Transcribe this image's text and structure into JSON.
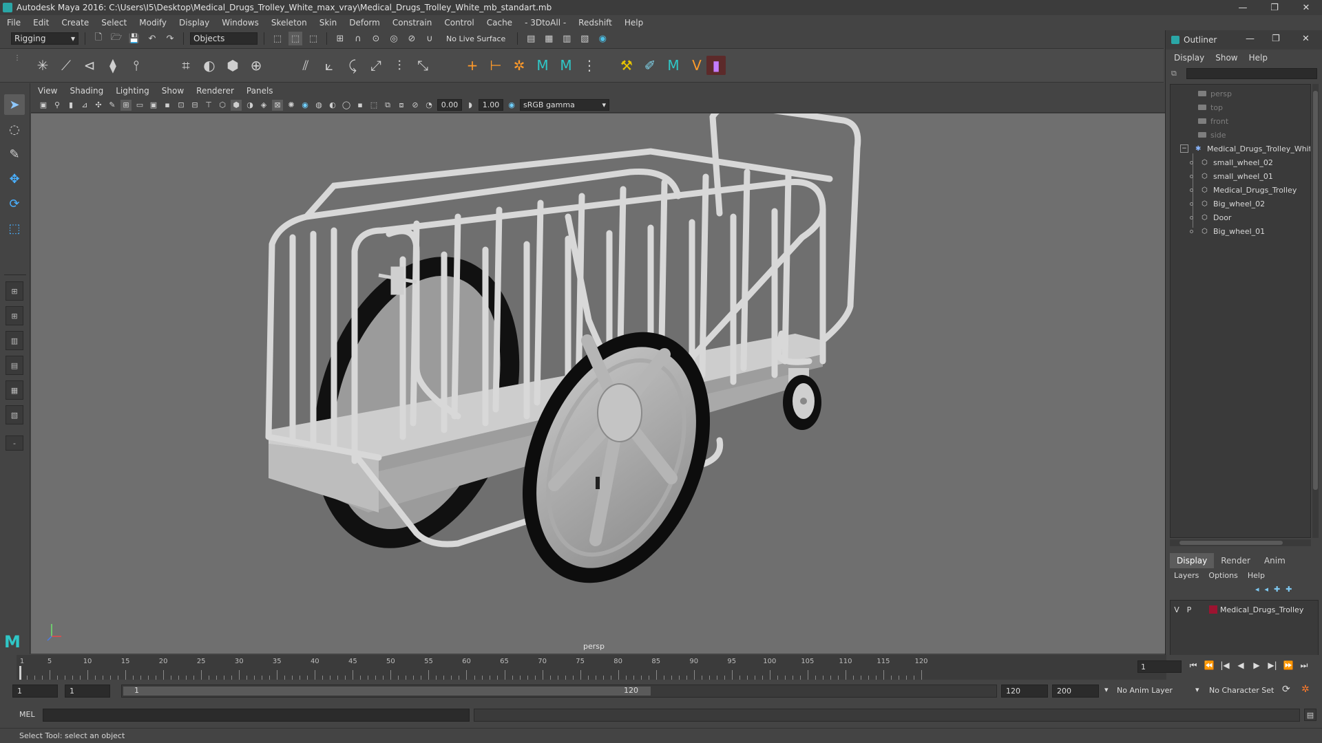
{
  "window": {
    "title": "Autodesk Maya 2016: C:\\Users\\I5\\Desktop\\Medical_Drugs_Trolley_White_max_vray\\Medical_Drugs_Trolley_White_mb_standart.mb",
    "controls": [
      "—",
      "❐",
      "✕"
    ]
  },
  "menubar": [
    "File",
    "Edit",
    "Create",
    "Select",
    "Modify",
    "Display",
    "Windows",
    "Skeleton",
    "Skin",
    "Deform",
    "Constrain",
    "Control",
    "Cache",
    "- 3DtoAll -",
    "Redshift",
    "Help"
  ],
  "statusline": {
    "menuset": "Rigging",
    "selection_mode": "Objects",
    "live_surface": "No Live Surface"
  },
  "panel": {
    "menu": [
      "View",
      "Shading",
      "Lighting",
      "Show",
      "Renderer",
      "Panels"
    ],
    "exposure": "0.00",
    "gamma": "1.00",
    "color_space": "sRGB gamma",
    "camera_label": "persp"
  },
  "outliner": {
    "title": "Outliner",
    "menu": [
      "Display",
      "Show",
      "Help"
    ],
    "cameras": [
      "persp",
      "top",
      "front",
      "side"
    ],
    "group": "Medical_Drugs_Trolley_White",
    "children": [
      "small_wheel_02",
      "small_wheel_01",
      "Medical_Drugs_Trolley",
      "Big_wheel_02",
      "Door",
      "Big_wheel_01"
    ]
  },
  "layer_editor": {
    "tabs": [
      "Display",
      "Render",
      "Anim"
    ],
    "active_tab": "Display",
    "menu": [
      "Layers",
      "Options",
      "Help"
    ],
    "layer": {
      "v": "V",
      "p": "P",
      "name": "Medical_Drugs_Trolley",
      "color": "#9c1430"
    }
  },
  "timeline": {
    "ticks": [
      1,
      5,
      10,
      15,
      20,
      25,
      30,
      35,
      40,
      45,
      50,
      55,
      60,
      65,
      70,
      75,
      80,
      85,
      90,
      95,
      100,
      105,
      110,
      115,
      120
    ],
    "current_frame": "1",
    "playback": [
      "⏮",
      "⏪",
      "|◀",
      "◀",
      "▶",
      "▶|",
      "⏩",
      "⏭"
    ]
  },
  "range": {
    "start": "1",
    "playback_start": "1",
    "slider_start": "1",
    "slider_end": "120",
    "playback_end": "120",
    "end": "200",
    "anim_layer": "No Anim Layer",
    "character_set": "No Character Set"
  },
  "cmdline": {
    "label": "MEL"
  },
  "helpline": {
    "text": "Select Tool: select an object"
  }
}
